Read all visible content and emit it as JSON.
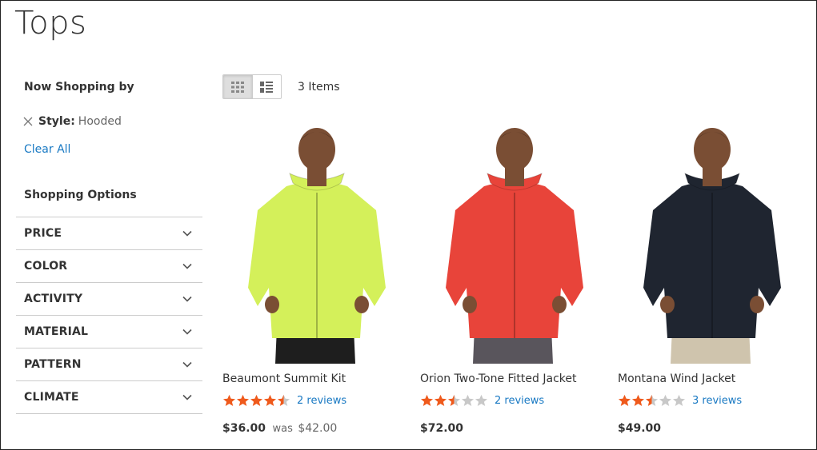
{
  "page": {
    "title": "Tops"
  },
  "sidebar": {
    "now_shopping_heading": "Now Shopping by",
    "active_filter": {
      "label": "Style:",
      "value": "Hooded"
    },
    "clear_all": "Clear All",
    "shopping_options_heading": "Shopping Options",
    "options": [
      {
        "label": "PRICE"
      },
      {
        "label": "COLOR"
      },
      {
        "label": "ACTIVITY"
      },
      {
        "label": "MATERIAL"
      },
      {
        "label": "PATTERN"
      },
      {
        "label": "CLIMATE"
      }
    ]
  },
  "toolbar": {
    "modes": [
      {
        "icon": "grid-icon",
        "active": true
      },
      {
        "icon": "list-icon",
        "active": false
      }
    ],
    "item_count": "3 Items"
  },
  "products": [
    {
      "name": "Beaumont Summit Kit",
      "rating": 4.5,
      "reviews": "2 reviews",
      "price": "$36.00",
      "old_label": "was",
      "old_price": "$42.00",
      "jacket_color": "#d4f05a",
      "pants_color": "#1e1e1e"
    },
    {
      "name": "Orion Two-Tone Fitted Jacket",
      "rating": 2.5,
      "reviews": "2 reviews",
      "price": "$72.00",
      "old_label": "",
      "old_price": "",
      "jacket_color": "#e8443a",
      "pants_color": "#59555c"
    },
    {
      "name": "Montana Wind Jacket",
      "rating": 2.5,
      "reviews": "3 reviews",
      "price": "$49.00",
      "old_label": "",
      "old_price": "",
      "jacket_color": "#1f2530",
      "pants_color": "#cfc4ad"
    }
  ],
  "colors": {
    "star_filled": "#ef5a1c",
    "star_empty": "#c8c8c8",
    "link": "#1979c3",
    "skin": "#7a4e34"
  }
}
